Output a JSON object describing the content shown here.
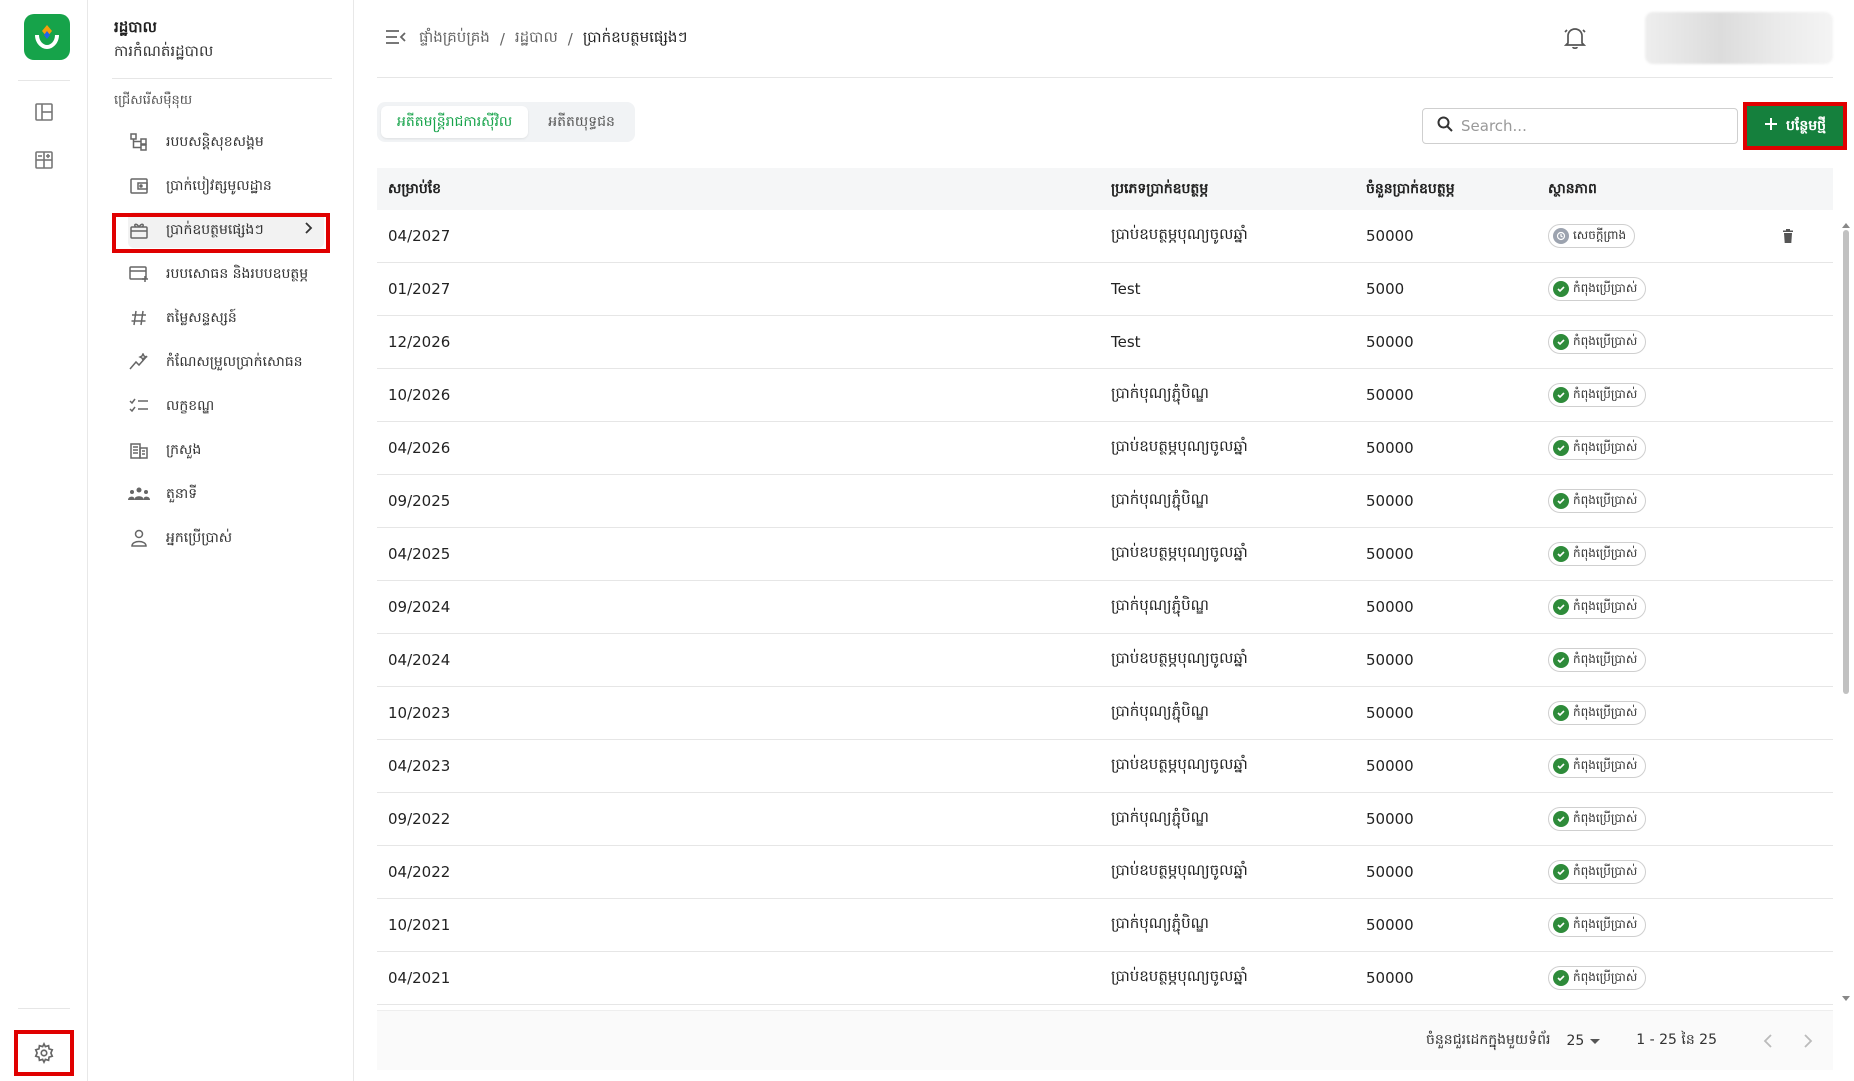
{
  "org": {
    "title": "រដ្ឋបាល",
    "subtitle": "ការកំណត់រដ្ឋបាល"
  },
  "sidebar": {
    "heading": "ជ្រើសរើសម៉ឺនុយ",
    "items": [
      {
        "label": "របបសន្តិសុខសង្គម",
        "icon": "hierarchy-icon"
      },
      {
        "label": "ប្រាក់បៀវត្សមូលដ្ឋាន",
        "icon": "wallet-icon"
      },
      {
        "label": "ប្រាក់ឧបត្ថមផ្សេងៗ",
        "icon": "gift-icon"
      },
      {
        "label": "របបសោធន និងរបបឧបត្ថម្ភ",
        "icon": "card-plus-icon"
      },
      {
        "label": "តម្លៃសន្ទស្សន៍",
        "icon": "hash-icon"
      },
      {
        "label": "កំណែសម្រួលប្រាក់សោធន",
        "icon": "sparkle-icon"
      },
      {
        "label": "លក្ខខណ្ឌ",
        "icon": "checklist-icon"
      },
      {
        "label": "ក្រសួង",
        "icon": "building-icon"
      },
      {
        "label": "តួនាទី",
        "icon": "group-icon"
      },
      {
        "label": "អ្នកប្រើប្រាស់",
        "icon": "user-icon"
      }
    ]
  },
  "breadcrumb": {
    "home": "ផ្ទាំងគ្រប់គ្រង",
    "sep": "/",
    "section": "រដ្ឋបាល",
    "current": "ប្រាក់ឧបត្ថមផ្សេងៗ"
  },
  "tabs": [
    "អតីតមន្ត្រីរាជការស៊ីវិល",
    "អតីតយុទ្ធជន"
  ],
  "search": {
    "placeholder": "Search..."
  },
  "toolbar": {
    "add_label": "បន្ថែមថ្មី"
  },
  "table": {
    "headers": [
      "សម្រាប់ខែ",
      "ប្រភេទប្រាក់ឧបត្ថម្ភ",
      "ចំនួនប្រាក់ឧបត្ថម្ភ",
      "ស្ថានភាព"
    ],
    "rows": [
      {
        "month": "04/2027",
        "type": "ប្រាប់ឧបត្ថម្ភបុណ្យចូលឆ្នាំ",
        "amount": "50000",
        "status": "សេចក្ដីព្រាង",
        "status_kind": "pending",
        "deletable": true
      },
      {
        "month": "01/2027",
        "type": "Test",
        "amount": "5000",
        "status": "កំពុងប្រើប្រាស់",
        "status_kind": "ok",
        "deletable": false
      },
      {
        "month": "12/2026",
        "type": "Test",
        "amount": "50000",
        "status": "កំពុងប្រើប្រាស់",
        "status_kind": "ok",
        "deletable": false
      },
      {
        "month": "10/2026",
        "type": "ប្រាក់បុណ្យភ្ជុំបិណ្ឌ",
        "amount": "50000",
        "status": "កំពុងប្រើប្រាស់",
        "status_kind": "ok",
        "deletable": false
      },
      {
        "month": "04/2026",
        "type": "ប្រាប់ឧបត្ថម្ភបុណ្យចូលឆ្នាំ",
        "amount": "50000",
        "status": "កំពុងប្រើប្រាស់",
        "status_kind": "ok",
        "deletable": false
      },
      {
        "month": "09/2025",
        "type": "ប្រាក់បុណ្យភ្ជុំបិណ្ឌ",
        "amount": "50000",
        "status": "កំពុងប្រើប្រាស់",
        "status_kind": "ok",
        "deletable": false
      },
      {
        "month": "04/2025",
        "type": "ប្រាប់ឧបត្ថម្ភបុណ្យចូលឆ្នាំ",
        "amount": "50000",
        "status": "កំពុងប្រើប្រាស់",
        "status_kind": "ok",
        "deletable": false
      },
      {
        "month": "09/2024",
        "type": "ប្រាក់បុណ្យភ្ជុំបិណ្ឌ",
        "amount": "50000",
        "status": "កំពុងប្រើប្រាស់",
        "status_kind": "ok",
        "deletable": false
      },
      {
        "month": "04/2024",
        "type": "ប្រាប់ឧបត្ថម្ភបុណ្យចូលឆ្នាំ",
        "amount": "50000",
        "status": "កំពុងប្រើប្រាស់",
        "status_kind": "ok",
        "deletable": false
      },
      {
        "month": "10/2023",
        "type": "ប្រាក់បុណ្យភ្ជុំបិណ្ឌ",
        "amount": "50000",
        "status": "កំពុងប្រើប្រាស់",
        "status_kind": "ok",
        "deletable": false
      },
      {
        "month": "04/2023",
        "type": "ប្រាប់ឧបត្ថម្ភបុណ្យចូលឆ្នាំ",
        "amount": "50000",
        "status": "កំពុងប្រើប្រាស់",
        "status_kind": "ok",
        "deletable": false
      },
      {
        "month": "09/2022",
        "type": "ប្រាក់បុណ្យភ្ជុំបិណ្ឌ",
        "amount": "50000",
        "status": "កំពុងប្រើប្រាស់",
        "status_kind": "ok",
        "deletable": false
      },
      {
        "month": "04/2022",
        "type": "ប្រាប់ឧបត្ថម្ភបុណ្យចូលឆ្នាំ",
        "amount": "50000",
        "status": "កំពុងប្រើប្រាស់",
        "status_kind": "ok",
        "deletable": false
      },
      {
        "month": "10/2021",
        "type": "ប្រាក់បុណ្យភ្ជុំបិណ្ឌ",
        "amount": "50000",
        "status": "កំពុងប្រើប្រាស់",
        "status_kind": "ok",
        "deletable": false
      },
      {
        "month": "04/2021",
        "type": "ប្រាប់ឧបត្ថម្ភបុណ្យចូលឆ្នាំ",
        "amount": "50000",
        "status": "កំពុងប្រើប្រាស់",
        "status_kind": "ok",
        "deletable": false
      }
    ]
  },
  "pagination": {
    "rows_per_page_label": "ចំនួនជួរដេកក្នុងមួយទំព័រ",
    "rows_per_page": "25",
    "range": "1 - 25 នៃ 25"
  },
  "colors": {
    "brand_green": "#15803d",
    "highlight_red": "#e00000",
    "tab_active": "#16a34a"
  }
}
